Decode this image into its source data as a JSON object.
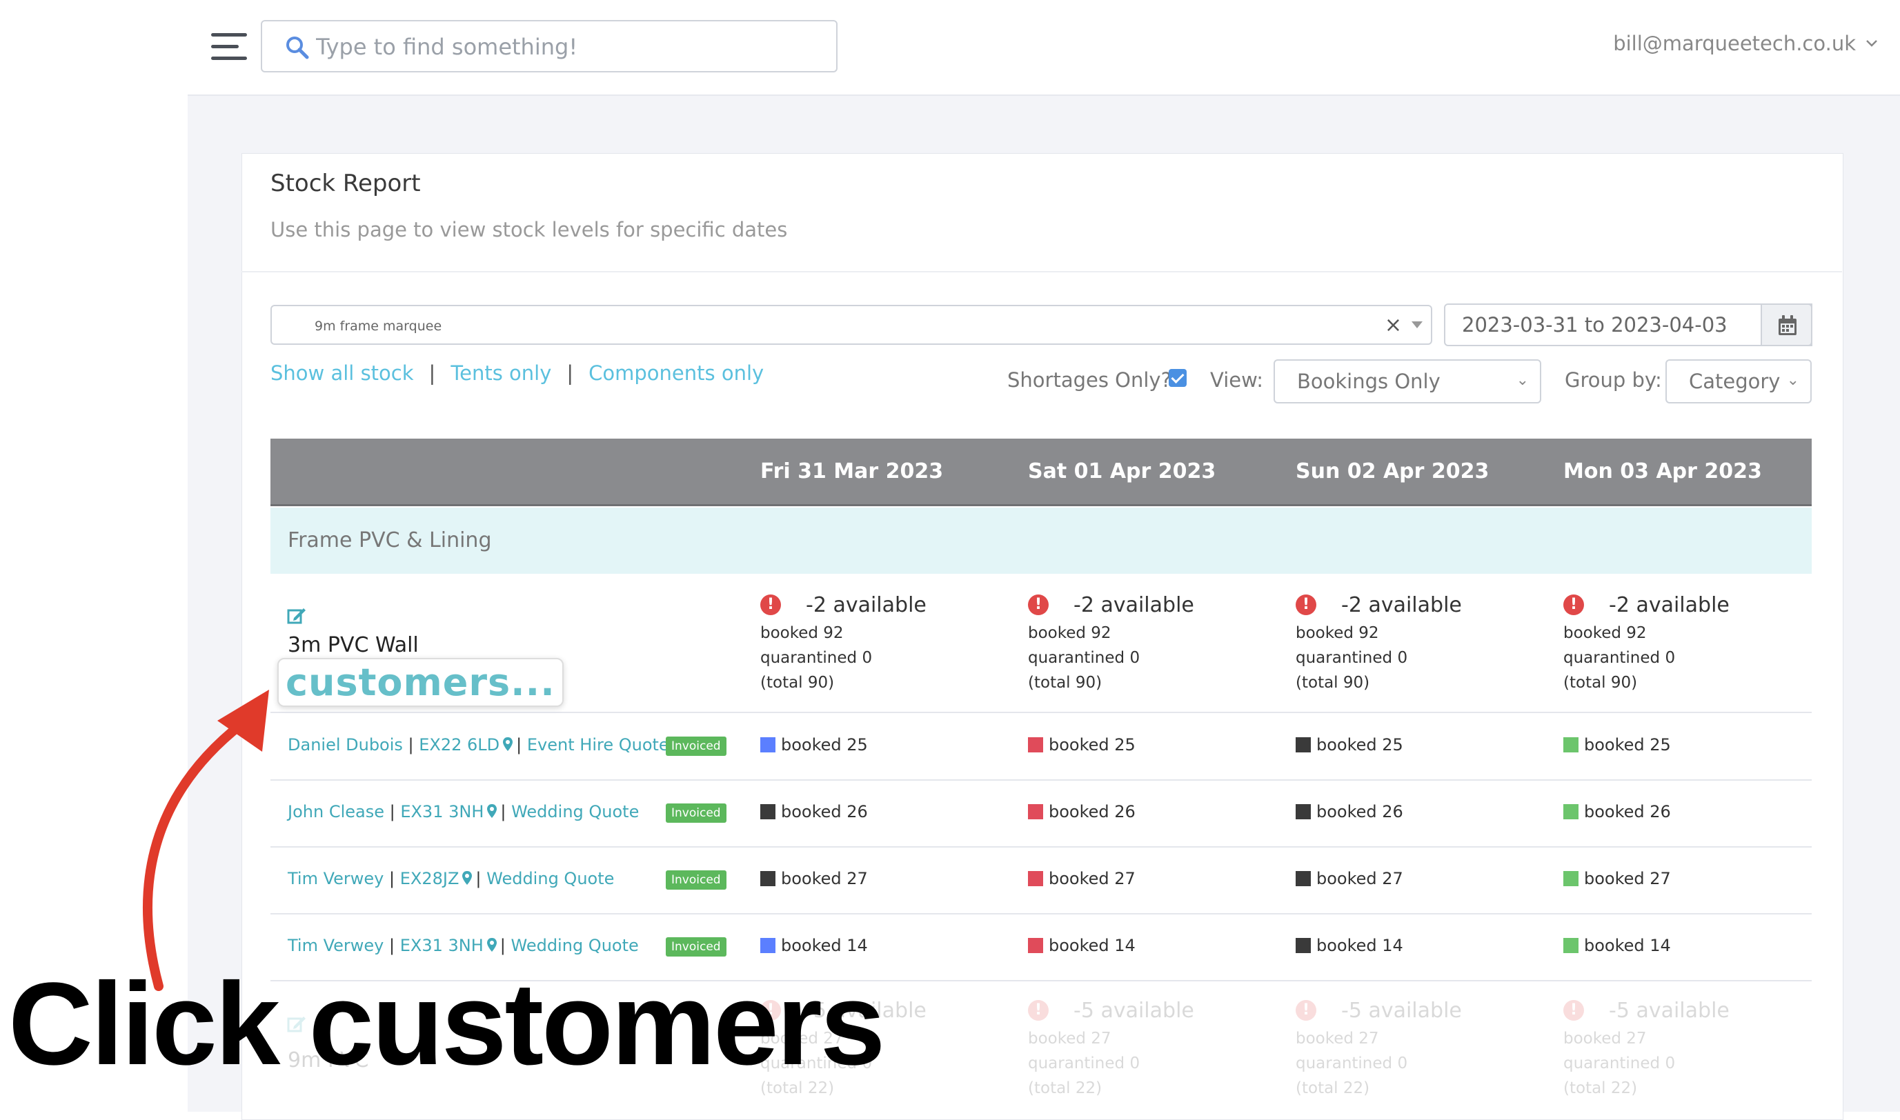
{
  "topbar": {
    "search_placeholder": "Type to find something!",
    "user_email": "bill@marqueetech.co.uk"
  },
  "page": {
    "title": "Stock Report",
    "subtitle": "Use this page to view stock levels for specific dates"
  },
  "filters": {
    "product_select_value": "9m frame marquee",
    "date_range": "2023-03-31 to 2023-04-03",
    "links": [
      "Show all stock",
      "Tents only",
      "Components only"
    ],
    "separator": "|",
    "shortages_label": "Shortages Only?",
    "shortages_checked": true,
    "view_label": "View:",
    "view_value": "Bookings Only",
    "group_label": "Group by:",
    "group_value": "Category"
  },
  "table": {
    "columns": [
      "Fri 31 Mar 2023",
      "Sat 01 Apr 2023",
      "Sun 02 Apr 2023",
      "Mon 03 Apr 2023"
    ],
    "category": "Frame PVC & Lining",
    "item": {
      "name": "3m PVC Wall",
      "customers_link": "customers...",
      "days": [
        {
          "available": "-2 available",
          "booked": "booked 92",
          "quarantined": "quarantined 0",
          "total": "(total 90)"
        },
        {
          "available": "-2 available",
          "booked": "booked 92",
          "quarantined": "quarantined 0",
          "total": "(total 90)"
        },
        {
          "available": "-2 available",
          "booked": "booked 92",
          "quarantined": "quarantined 0",
          "total": "(total 90)"
        },
        {
          "available": "-2 available",
          "booked": "booked 92",
          "quarantined": "quarantined 0",
          "total": "(total 90)"
        }
      ]
    },
    "bookings": [
      {
        "name": "Daniel Dubois",
        "postcode": "EX22 6LD",
        "quote": "Event Hire Quote",
        "status": "Invoiced",
        "booked": "booked 25",
        "colors": [
          "#5b7fff",
          "#e04b5a",
          "#3a3a3a",
          "#6cc56c"
        ]
      },
      {
        "name": "John Clease",
        "postcode": "EX31 3NH",
        "quote": "Wedding Quote",
        "status": "Invoiced",
        "booked": "booked 26",
        "colors": [
          "#3a3a3a",
          "#e04b5a",
          "#3a3a3a",
          "#6cc56c"
        ]
      },
      {
        "name": "Tim Verwey",
        "postcode": "EX28JZ",
        "quote": "Wedding Quote",
        "status": "Invoiced",
        "booked": "booked 27",
        "colors": [
          "#3a3a3a",
          "#e04b5a",
          "#3a3a3a",
          "#6cc56c"
        ]
      },
      {
        "name": "Tim Verwey",
        "postcode": "EX31 3NH",
        "quote": "Wedding Quote",
        "status": "Invoiced",
        "booked": "booked 14",
        "colors": [
          "#5b7fff",
          "#e04b5a",
          "#3a3a3a",
          "#6cc56c"
        ]
      }
    ],
    "next_item": {
      "name_partial": "9m PVC",
      "days": [
        {
          "available": "-5 available",
          "booked": "booked 27",
          "quarantined": "quarantined 0",
          "total": "(total 22)"
        },
        {
          "available": "-5 available",
          "booked": "booked 27",
          "quarantined": "quarantined 0",
          "total": "(total 22)"
        },
        {
          "available": "-5 available",
          "booked": "booked 27",
          "quarantined": "quarantined 0",
          "total": "(total 22)"
        },
        {
          "available": "-5 available",
          "booked": "booked 27",
          "quarantined": "quarantined 0",
          "total": "(total 22)"
        }
      ]
    }
  },
  "annotation": {
    "caption": "Click customers",
    "arrow_color": "#e03a2a"
  }
}
